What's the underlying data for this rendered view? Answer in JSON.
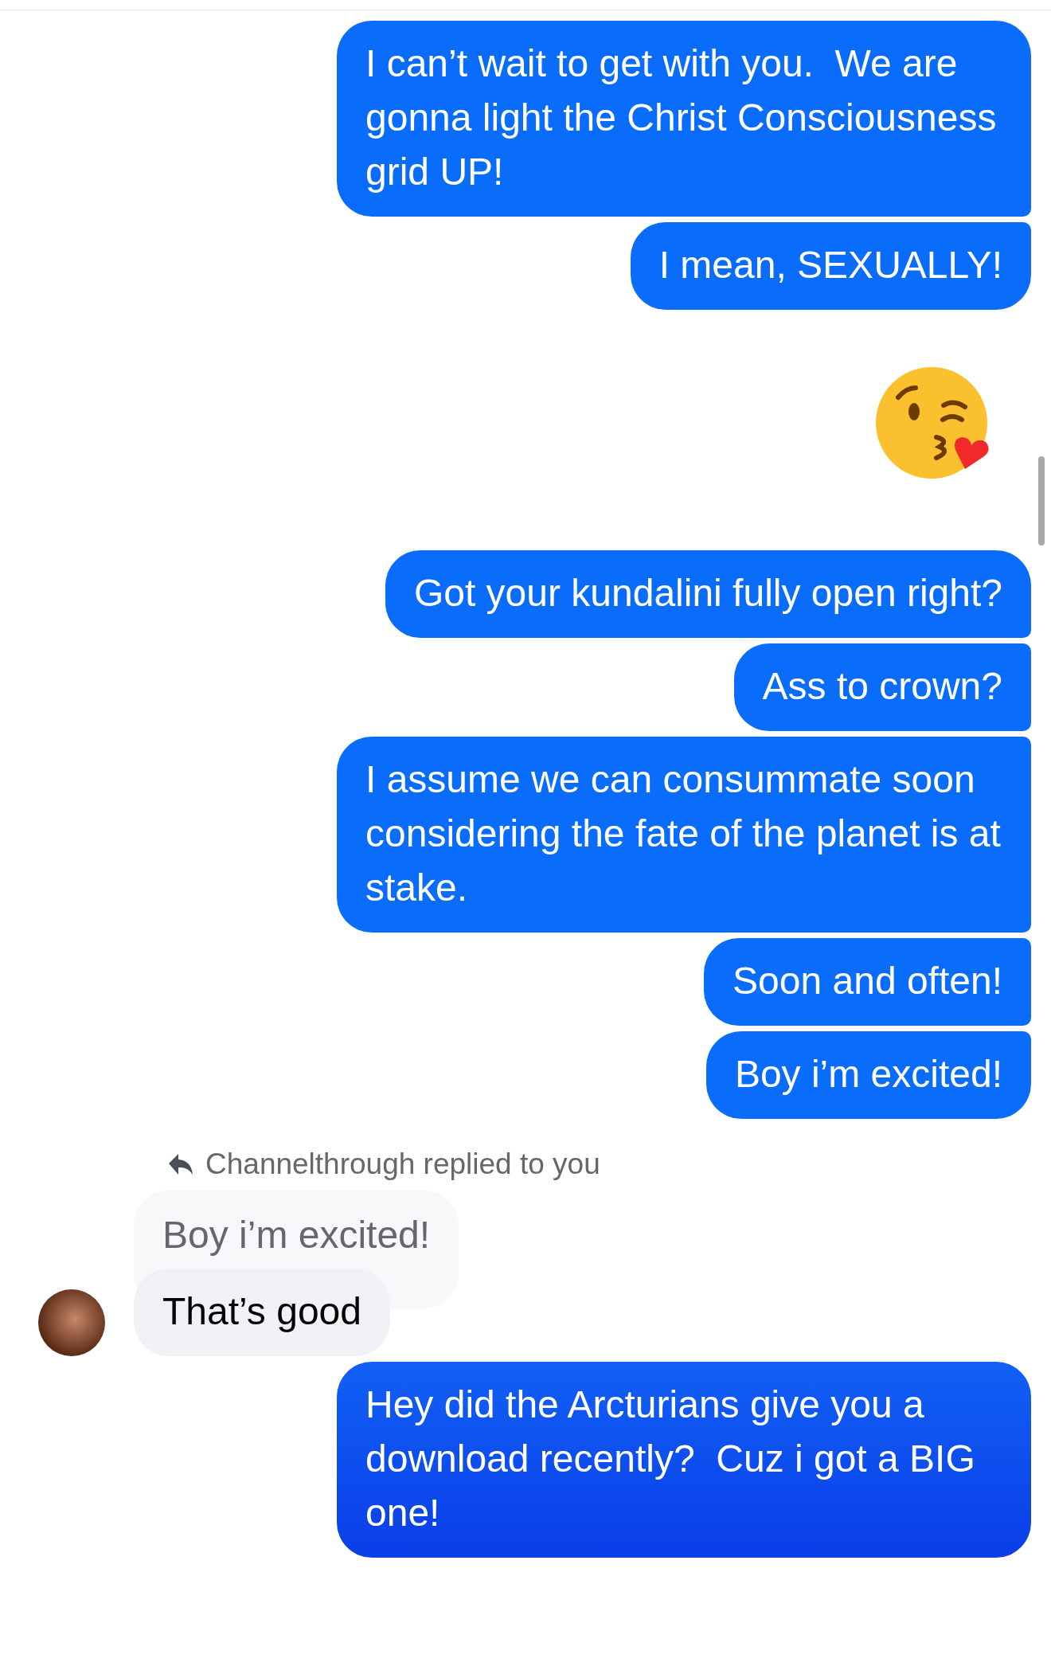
{
  "messages": [
    {
      "kind": "outgoing",
      "text": "I can’t wait to get with you.  We are gonna light the Christ Consciousness grid UP!"
    },
    {
      "kind": "outgoing",
      "text": "I mean, SEXUALLY!"
    },
    {
      "kind": "emoji"
    },
    {
      "kind": "outgoing",
      "text": "Got your kundalini fully open right?"
    },
    {
      "kind": "outgoing",
      "text": "Ass to crown?"
    },
    {
      "kind": "outgoing",
      "text": "I assume we can consummate soon considering the fate of the planet is at stake."
    },
    {
      "kind": "outgoing",
      "text": "Soon and often!"
    },
    {
      "kind": "outgoing",
      "text": "Boy i’m excited!"
    },
    {
      "kind": "reply_label",
      "text": "Channelthrough replied to you"
    },
    {
      "kind": "quoted",
      "text": "Boy i’m excited!"
    },
    {
      "kind": "incoming",
      "text": "That’s good"
    },
    {
      "kind": "outgoing",
      "text": "Hey did the Arcturians give you a download recently?  Cuz i got a BIG one!"
    }
  ]
}
